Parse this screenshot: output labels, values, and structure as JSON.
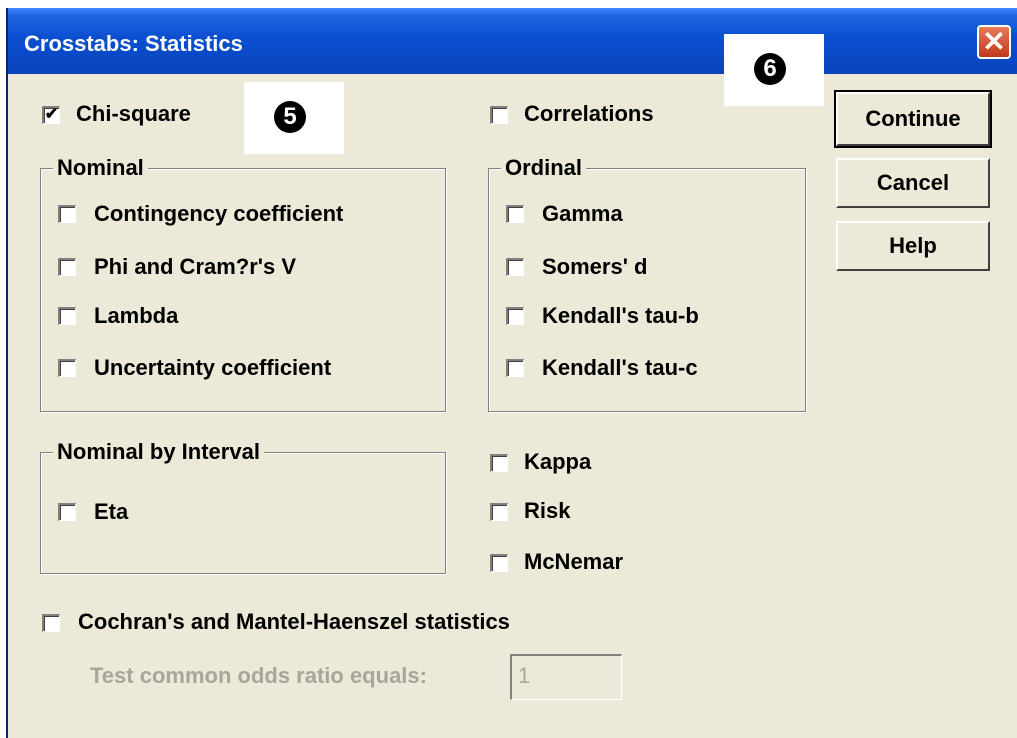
{
  "window": {
    "title": "Crosstabs: Statistics",
    "close_glyph": "✕"
  },
  "badges": {
    "five": "5",
    "six": "6"
  },
  "options": {
    "chi_square": {
      "label": "Chi-square",
      "checked": "✔"
    },
    "correlations": {
      "label": "Correlations",
      "checked": ""
    }
  },
  "nominal": {
    "title": "Nominal",
    "items": [
      {
        "label": "Contingency coefficient",
        "checked": ""
      },
      {
        "label": "Phi and Cram?r's V",
        "checked": ""
      },
      {
        "label": "Lambda",
        "checked": ""
      },
      {
        "label": "Uncertainty coefficient",
        "checked": ""
      }
    ]
  },
  "ordinal": {
    "title": "Ordinal",
    "items": [
      {
        "label": "Gamma",
        "checked": ""
      },
      {
        "label": "Somers' d",
        "checked": ""
      },
      {
        "label": "Kendall's tau-b",
        "checked": ""
      },
      {
        "label": "Kendall's tau-c",
        "checked": ""
      }
    ]
  },
  "nominal_by_interval": {
    "title": "Nominal by Interval",
    "items": [
      {
        "label": "Eta",
        "checked": ""
      }
    ]
  },
  "other": {
    "kappa": {
      "label": "Kappa",
      "checked": ""
    },
    "risk": {
      "label": "Risk",
      "checked": ""
    },
    "mcnemar": {
      "label": "McNemar",
      "checked": ""
    }
  },
  "cmh": {
    "label": "Cochran's and Mantel-Haenszel statistics",
    "checked": "",
    "odds_label": "Test common odds ratio equals:",
    "odds_value": "1"
  },
  "buttons": {
    "continue": "Continue",
    "cancel": "Cancel",
    "help": "Help"
  }
}
